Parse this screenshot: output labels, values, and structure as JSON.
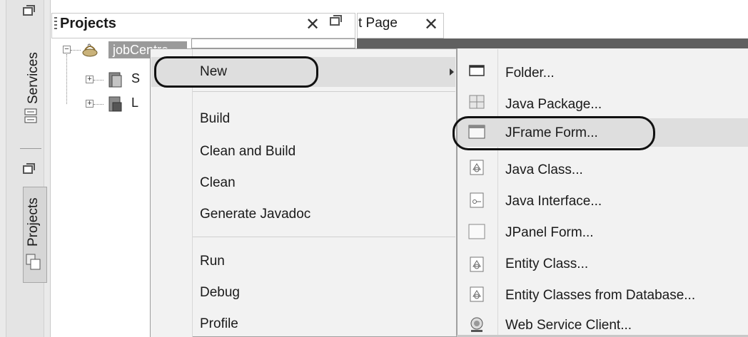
{
  "left_strip": {
    "services_label": "Services",
    "projects_label": "Projects",
    "icons": [
      "window-restore-icon",
      "services-icon",
      "window-restore-icon",
      "projects-icon"
    ]
  },
  "projects_panel": {
    "title": "Projects",
    "close_glyph": "✕",
    "root_label": "jobCentre",
    "root_label_visible": "jobC",
    "child_labels": [
      "S",
      "L"
    ]
  },
  "editor_tab": {
    "label": "t Page",
    "close_glyph": "✕"
  },
  "context_menu": {
    "new_label": "New",
    "group2": [
      "Build",
      "Clean and Build",
      "Clean",
      "Generate Javadoc"
    ],
    "group3": [
      "Run",
      "Debug",
      "Profile"
    ]
  },
  "submenu": {
    "items": [
      {
        "label": "Folder...",
        "icon": "folder-icon"
      },
      {
        "label": "Java Package...",
        "icon": "package-icon"
      },
      {
        "label": "JFrame Form...",
        "icon": "jframe-icon"
      },
      {
        "label": "Java Class...",
        "icon": "java-class-icon"
      },
      {
        "label": "Java Interface...",
        "icon": "java-interface-icon"
      },
      {
        "label": "JPanel Form...",
        "icon": "jpanel-icon"
      },
      {
        "label": "Entity Class...",
        "icon": "entity-class-icon"
      },
      {
        "label": "Entity Classes from Database...",
        "icon": "entity-db-icon"
      },
      {
        "label": "Web Service Client...",
        "icon": "web-service-icon"
      }
    ]
  },
  "colors": {
    "menu_bg": "#f2f2f2",
    "highlight": "#dedede",
    "selection_gray": "#9a9a9a",
    "annotation_outline": "#111111"
  }
}
